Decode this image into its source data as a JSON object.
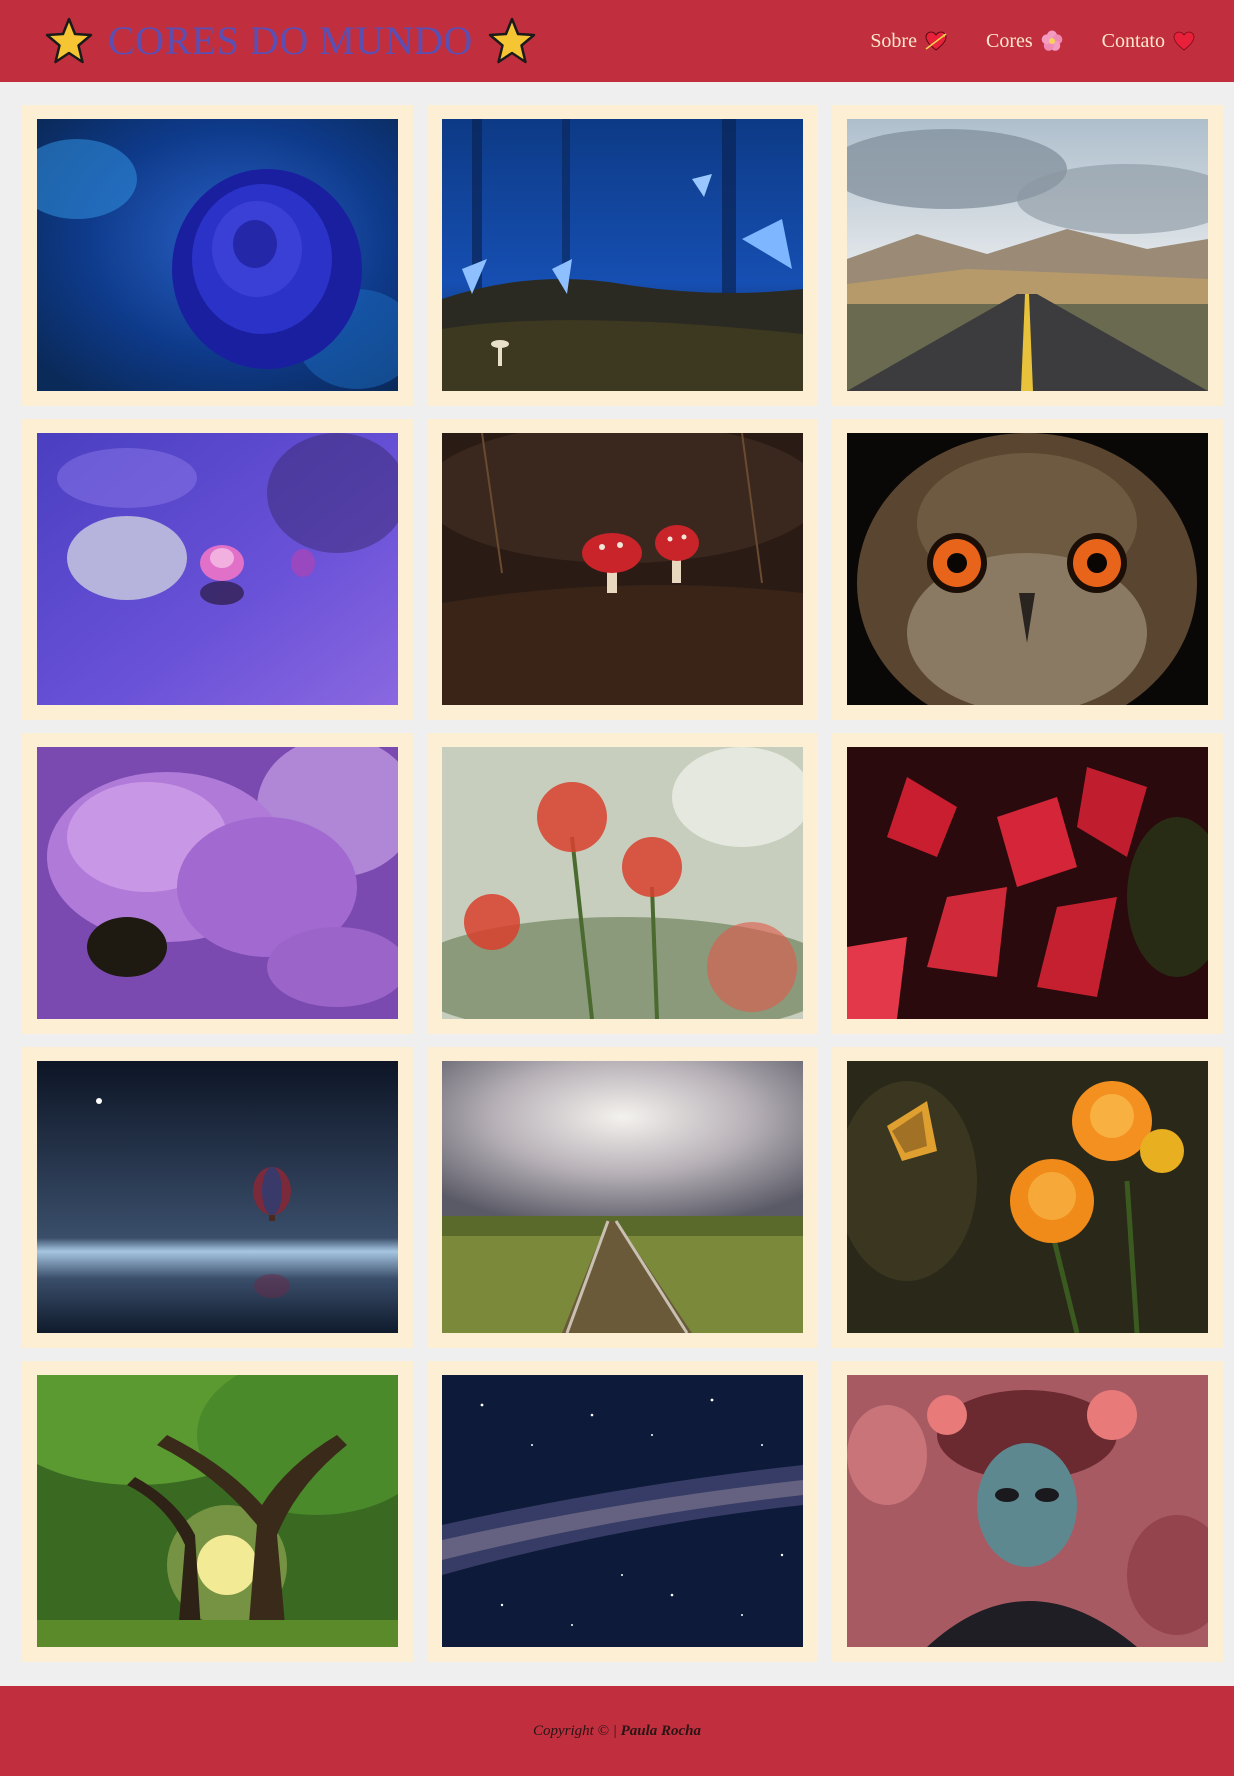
{
  "header": {
    "title": "CORES DO MUNDO",
    "left_icon": "star-icon",
    "right_icon": "star-icon",
    "nav": [
      {
        "label": "Sobre",
        "icon": "heart-arrow-icon"
      },
      {
        "label": "Cores",
        "icon": "flower-icon"
      },
      {
        "label": "Contato",
        "icon": "heart-icon"
      }
    ]
  },
  "gallery": {
    "photos": [
      {
        "subject": "blue-rose"
      },
      {
        "subject": "blue-butterflies-forest"
      },
      {
        "subject": "mountain-road"
      },
      {
        "subject": "purple-lotus-pond"
      },
      {
        "subject": "red-mushrooms"
      },
      {
        "subject": "owl-face"
      },
      {
        "subject": "purple-flowers"
      },
      {
        "subject": "red-spider-lilies"
      },
      {
        "subject": "red-leaves"
      },
      {
        "subject": "hot-air-balloon-night"
      },
      {
        "subject": "railway-track-field"
      },
      {
        "subject": "orange-flowers-butterfly"
      },
      {
        "subject": "sunlit-trees"
      },
      {
        "subject": "milky-way"
      },
      {
        "subject": "masked-woman-roses"
      }
    ]
  },
  "footer": {
    "copyright_prefix": "Copyright © | ",
    "author": "Paula Rocha"
  },
  "colors": {
    "header_bg": "#c12f3f",
    "footer_bg": "#c12f3f",
    "title_color": "#5b4fb3",
    "nav_text": "#fde8c8",
    "card_bg": "#fdefd4",
    "page_bg": "#efefef"
  }
}
